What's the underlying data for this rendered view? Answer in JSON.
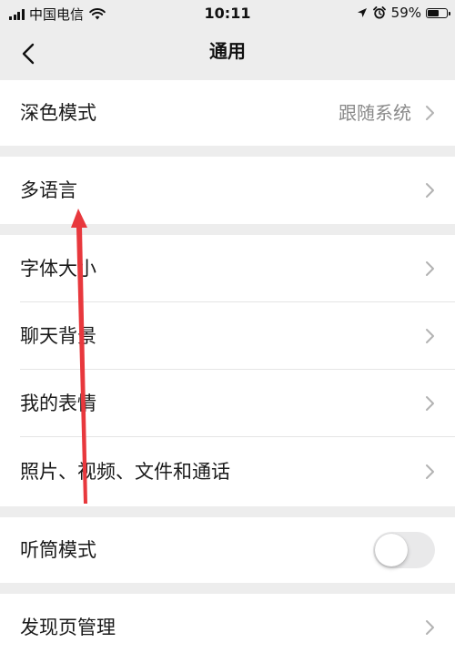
{
  "status_bar": {
    "carrier": "中国电信",
    "time": "10:11",
    "battery_percent": "59%",
    "battery_level": 0.59,
    "icons": [
      "signal-icon",
      "wifi-icon",
      "location-icon",
      "alarm-icon",
      "battery-icon"
    ]
  },
  "nav": {
    "title": "通用",
    "back_icon": "chevron-left-icon"
  },
  "settings": {
    "dark_mode": {
      "label": "深色模式",
      "value": "跟随系统"
    },
    "language": {
      "label": "多语言"
    },
    "font_size": {
      "label": "字体大小"
    },
    "chat_background": {
      "label": "聊天背景"
    },
    "my_stickers": {
      "label": "我的表情"
    },
    "media_files": {
      "label": "照片、视频、文件和通话"
    },
    "earpiece_mode": {
      "label": "听筒模式",
      "enabled": false
    },
    "discover_manage": {
      "label": "发现页管理"
    }
  },
  "colors": {
    "background": "#ededed",
    "row_background": "#ffffff",
    "secondary_text": "#8a8a8a",
    "annotation_arrow": "#e8383d"
  }
}
